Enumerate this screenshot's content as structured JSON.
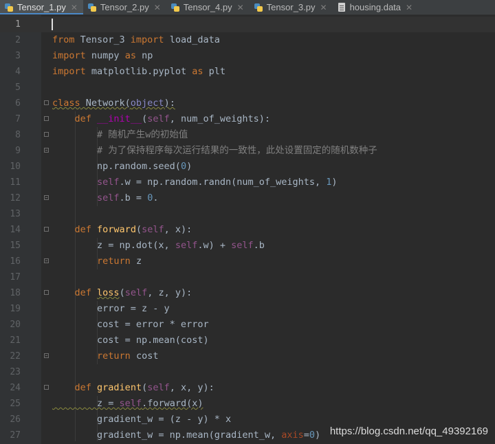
{
  "tabs": [
    {
      "label": "Tensor_1.py",
      "icon": "python-file-icon",
      "active": true
    },
    {
      "label": "Tensor_2.py",
      "icon": "python-file-icon"
    },
    {
      "label": "Tensor_4.py",
      "icon": "python-file-icon"
    },
    {
      "label": "Tensor_3.py",
      "icon": "python-file-icon"
    },
    {
      "label": "housing.data",
      "icon": "data-file-icon"
    }
  ],
  "editor": {
    "line_numbers": [
      "1",
      "2",
      "3",
      "4",
      "5",
      "6",
      "7",
      "8",
      "9",
      "10",
      "11",
      "12",
      "13",
      "14",
      "15",
      "16",
      "17",
      "18",
      "19",
      "20",
      "21",
      "22",
      "23",
      "24",
      "25",
      "26",
      "27"
    ],
    "lines": [
      "",
      "from Tensor_3 import load_data",
      "import numpy as np",
      "import matplotlib.pyplot as plt",
      "",
      "class Network(object):",
      "    def __init__(self, num_of_weights):",
      "        # 随机产生w的初始值",
      "        # 为了保持程序每次运行结果的一致性，此处设置固定的随机数种子",
      "        np.random.seed(0)",
      "        self.w = np.random.randn(num_of_weights, 1)",
      "        self.b = 0.",
      "",
      "    def forward(self, x):",
      "        z = np.dot(x, self.w) + self.b",
      "        return z",
      "",
      "    def loss(self, z, y):",
      "        error = z - y",
      "        cost = error * error",
      "        cost = np.mean(cost)",
      "        return cost",
      "",
      "    def gradient(self, x, y):",
      "        z = self.forward(x)",
      "        gradient_w = (z - y) * x",
      "        gradient_w = np.mean(gradient_w, axis=0)"
    ],
    "colors": {
      "background": "#2b2b2b",
      "gutter": "#313335",
      "keyword": "#cc7832",
      "function": "#ffc66d",
      "self": "#94558d",
      "number": "#6897bb",
      "comment": "#808080",
      "text": "#a9b7c6"
    }
  },
  "watermark": "https://blog.csdn.net/qq_49392169"
}
